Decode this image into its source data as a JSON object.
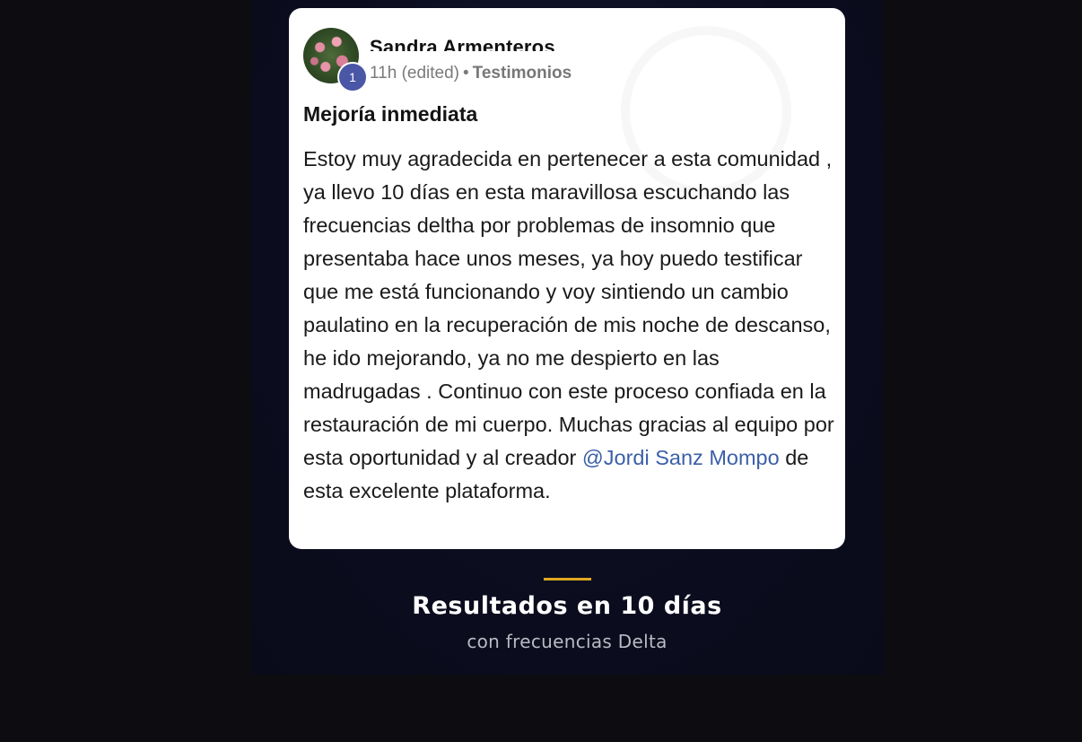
{
  "post": {
    "author": "Sandra Armenteros",
    "badge": "1",
    "time": "11h (edited)",
    "separator": "•",
    "group": "Testimonios",
    "title": "Mejoría inmediata",
    "body_before_mention": "Estoy muy agradecida en pertenecer a esta comunidad , ya llevo 10 días en esta maravillosa escuchando las frecuencias deltha por problemas de insomnio que presentaba hace unos meses, ya hoy puedo testificar que me está funcionando y voy sintiendo un cambio paulatino en la recuperación de mis noche de descanso, he ido mejorando, ya no me despierto en las madrugadas . Continuo con este proceso confiada en la restauración de mi cuerpo. Muchas gracias al equipo por esta oportunidad y al creador ",
    "mention": "@Jordi Sanz Mompo",
    "body_after_mention": " de esta excelente plataforma.",
    "mention_color": "#3c5fa8"
  },
  "caption": {
    "headline": "Resultados en 10 días",
    "subheadline": "con frecuencias Delta",
    "accent_color": "#e0a820"
  }
}
